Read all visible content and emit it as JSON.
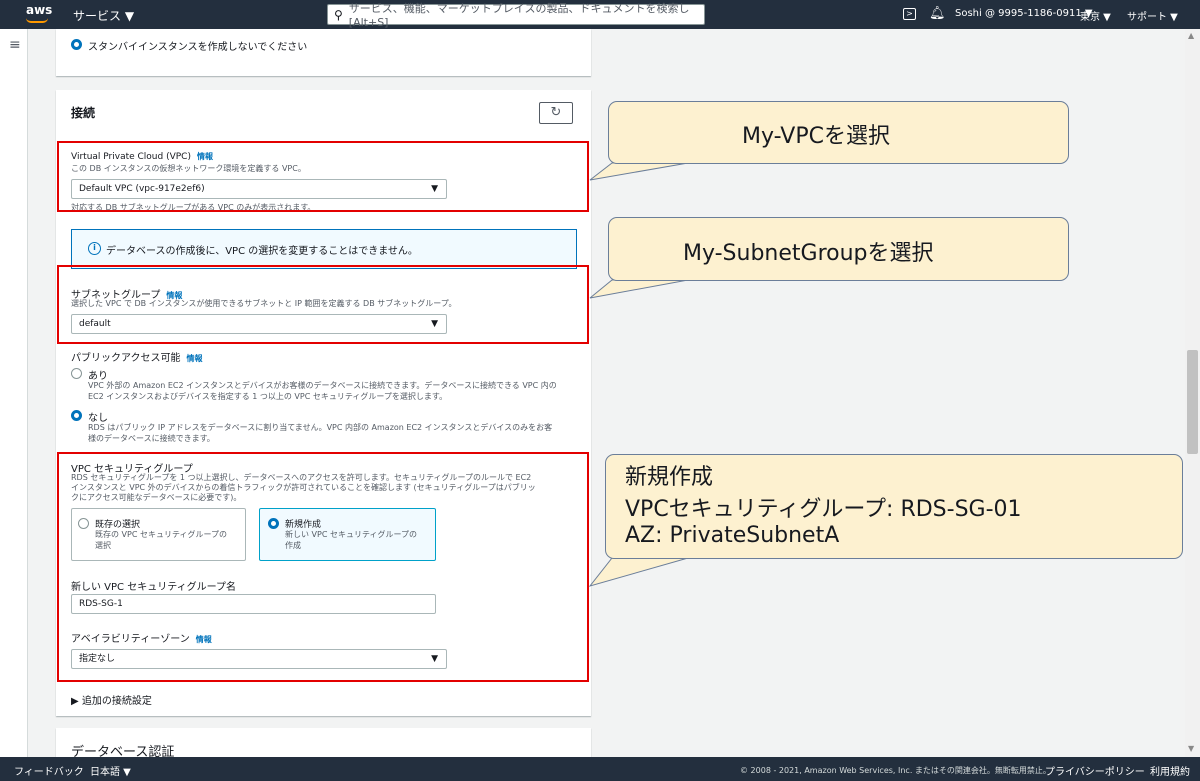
{
  "nav": {
    "logo": "aws",
    "services": "サービス ▼",
    "search_placeholder": "サービス、機能、マーケットプレイスの製品、ドキュメントを検索し　[Alt+S]",
    "account": "Soshi @ 9995-1186-0911 ▼",
    "region": "東京 ▼",
    "support": "サポート ▼"
  },
  "top_panel": {
    "standby_option": "スタンバイインスタンスを作成しないでください"
  },
  "connection": {
    "title": "接続",
    "vpc_label": "Virtual Private Cloud (VPC)",
    "info": "情報",
    "vpc_desc": "この DB インスタンスの仮想ネットワーク環境を定義する VPC。",
    "vpc_value": "Default VPC (vpc-917e2ef6)",
    "vpc_hint": "対応する DB サブネットグループがある VPC のみが表示されます。",
    "alert": "データベースの作成後に、VPC の選択を変更することはできません。",
    "subnet_label": "サブネットグループ",
    "subnet_desc": "選択した VPC で DB インスタンスが使用できるサブネットと IP 範囲を定義する DB サブネットグループ。",
    "subnet_value": "default",
    "public_label": "パブリックアクセス可能",
    "public_yes": "あり",
    "public_yes_desc1": "VPC 外部の Amazon EC2 インスタンスとデバイスがお客様のデータベースに接続できます。データベースに接続できる VPC 内の",
    "public_yes_desc2": "EC2 インスタンスおよびデバイスを指定する 1 つ以上の VPC セキュリティグループを選択します。",
    "public_no": "なし",
    "public_no_desc1": "RDS はパブリック IP アドレスをデータベースに割り当てません。VPC 内部の Amazon EC2 インスタンスとデバイスのみをお客",
    "public_no_desc2": "様のデータベースに接続できます。",
    "sg_label": "VPC セキュリティグループ",
    "sg_desc1": "RDS セキュリティグループを 1 つ以上選択し、データベースへのアクセスを許可します。セキュリティグループのルールで EC2",
    "sg_desc2": "インスタンスと VPC 外のデバイスからの着信トラフィックが許可されていることを確認します (セキュリティグループはパブリッ",
    "sg_desc3": "クにアクセス可能なデータベースに必要です)。",
    "sg_existing": "既存の選択",
    "sg_existing_desc1": "既存の VPC セキュリティグループの",
    "sg_existing_desc2": "選択",
    "sg_new": "新規作成",
    "sg_new_desc1": "新しい VPC セキュリティグループの",
    "sg_new_desc2": "作成",
    "sg_name_label": "新しい VPC セキュリティグループ名",
    "sg_name_value": "RDS-SG-1",
    "az_label": "アベイラビリティーゾーン",
    "az_value": "指定なし",
    "additional": "追加の接続設定"
  },
  "db_auth": {
    "title": "データベース認証"
  },
  "callouts": {
    "vpc": "My-VPCを選択",
    "subnet": "My-SubnetGroupを選択",
    "sg_line1": "新規作成",
    "sg_line2": "VPCセキュリティグループ: RDS-SG-01",
    "sg_line3": "AZ:  PrivateSubnetA"
  },
  "footer": {
    "feedback": "フィードバック",
    "language": "日本語 ▼",
    "copyright": "© 2008 - 2021, Amazon Web Services, Inc. またはその関連会社。無断転用禁止。",
    "privacy": "プライバシーポリシー",
    "terms": "利用規約"
  },
  "colors": {
    "nav_bg": "#232f3e",
    "accent": "#0073bb",
    "highlight": "#e30000",
    "callout_bg": "#fdf1d0"
  }
}
